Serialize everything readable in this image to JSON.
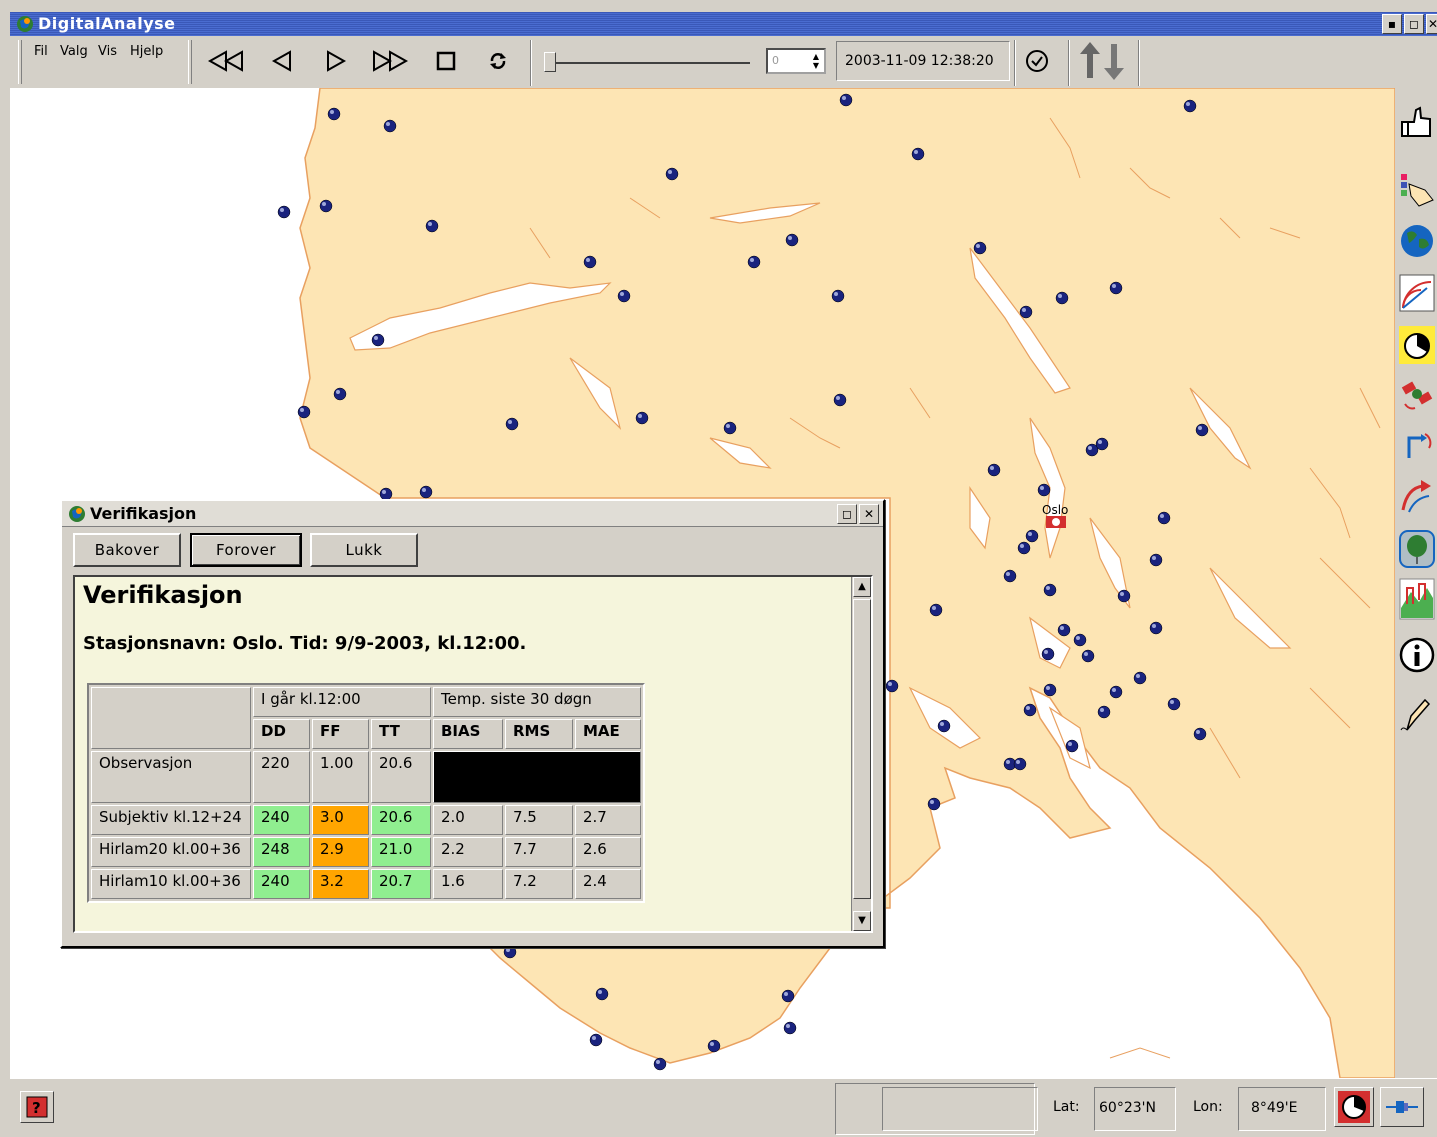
{
  "window": {
    "title": "DigitalAnalyse"
  },
  "menu": {
    "items": [
      "Fil",
      "Valg",
      "Vis",
      "Hjelp"
    ]
  },
  "toolbar": {
    "spin_value": "0",
    "datetime": "2003-11-09 12:38:20",
    "slider_position": 0
  },
  "map": {
    "city_label": "Oslo",
    "land_color": "#fde5b4",
    "coast_color": "#e8a060",
    "station_color": "#1a237e"
  },
  "dialog": {
    "title": "Verifikasjon",
    "buttons": [
      "Bakover",
      "Forover",
      "Lukk"
    ],
    "report_title": "Verifikasjon",
    "report_subtitle": "Stasjonsnavn: Oslo. Tid: 9/9-2003, kl.12:00.",
    "table": {
      "group_headers": [
        "I går kl.12:00",
        "Temp. siste 30 døgn"
      ],
      "columns": [
        "DD",
        "FF",
        "TT",
        "BIAS",
        "RMS",
        "MAE"
      ],
      "rows": [
        {
          "label": "Observasjon",
          "values": [
            "220",
            "1.00",
            "20.6",
            "",
            "",
            ""
          ]
        },
        {
          "label": "Subjektiv kl.12+24",
          "values": [
            "240",
            "3.0",
            "20.6",
            "2.0",
            "7.5",
            "2.7"
          ]
        },
        {
          "label": "Hirlam20 kl.00+36",
          "values": [
            "248",
            "2.9",
            "21.0",
            "2.2",
            "7.7",
            "2.6"
          ]
        },
        {
          "label": "Hirlam10 kl.00+36",
          "values": [
            "240",
            "3.2",
            "20.7",
            "1.6",
            "7.2",
            "2.4"
          ]
        }
      ]
    },
    "colors": {
      "good": "#90ee90",
      "warn": "#ffa500"
    }
  },
  "statusbar": {
    "lat_label": "Lat:",
    "lat_value": "60°23'N",
    "lon_label": "Lon:",
    "lon_value": "8°49'E"
  }
}
